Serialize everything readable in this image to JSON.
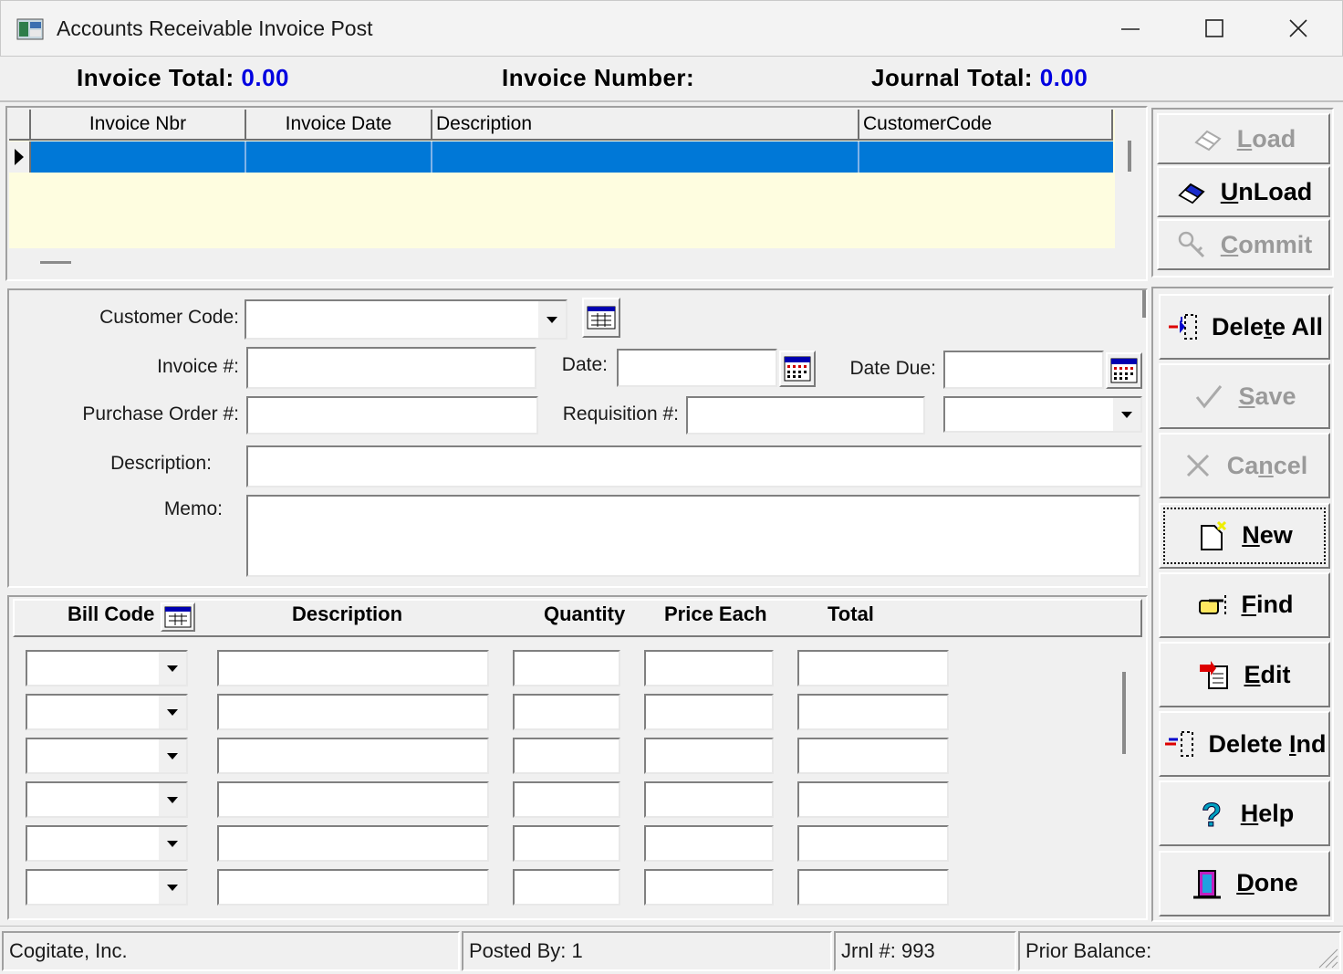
{
  "window": {
    "title": "Accounts Receivable Invoice Post"
  },
  "summary": {
    "invoice_total_label": "Invoice Total:",
    "invoice_total_value": "0.00",
    "invoice_number_label": "Invoice Number:",
    "invoice_number_value": "",
    "journal_total_label": "Journal Total:",
    "journal_total_value": "0.00"
  },
  "invoice_grid": {
    "columns": [
      "Invoice Nbr",
      "Invoice Date",
      "Description",
      "CustomerCode"
    ]
  },
  "form": {
    "customer_code_label": "Customer Code:",
    "invoice_no_label": "Invoice #:",
    "date_label": "Date:",
    "date_due_label": "Date Due:",
    "po_label": "Purchase Order #:",
    "requisition_label": "Requisition #:",
    "description_label": "Description:",
    "memo_label": "Memo:"
  },
  "detail": {
    "columns": [
      "Bill Code",
      "Description",
      "Quantity",
      "Price Each",
      "Total"
    ],
    "row_count": 6
  },
  "buttons_top": [
    {
      "name": "load-button",
      "label": "Load",
      "ul": "L",
      "rest": "oad",
      "enabled": false,
      "icon": "eraser-icon"
    },
    {
      "name": "unload-button",
      "label": "UnLoad",
      "ul": "U",
      "rest": "nLoad",
      "enabled": true,
      "icon": "blue-eraser-icon"
    },
    {
      "name": "commit-button",
      "label": "Commit",
      "ul": "C",
      "rest": "ommit",
      "enabled": false,
      "icon": "key-icon"
    }
  ],
  "buttons_side": [
    {
      "name": "delete-all-button",
      "label": "Delete All",
      "pre": "Dele",
      "ul": "t",
      "rest": "e All",
      "enabled": true,
      "icon": "delete-all-icon"
    },
    {
      "name": "save-button",
      "label": "Save",
      "pre": "",
      "ul": "S",
      "rest": "ave",
      "enabled": false,
      "icon": "checkmark-icon"
    },
    {
      "name": "cancel-button",
      "label": "Cancel",
      "pre": "Ca",
      "ul": "n",
      "rest": "cel",
      "enabled": false,
      "icon": "x-icon"
    },
    {
      "name": "new-button",
      "label": "New",
      "pre": "",
      "ul": "N",
      "rest": "ew",
      "enabled": true,
      "icon": "new-document-icon"
    },
    {
      "name": "find-button",
      "label": "Find",
      "pre": "",
      "ul": "F",
      "rest": "ind",
      "enabled": true,
      "icon": "pointing-hand-icon"
    },
    {
      "name": "edit-button",
      "label": "Edit",
      "pre": "",
      "ul": "E",
      "rest": "dit",
      "enabled": true,
      "icon": "edit-document-icon"
    },
    {
      "name": "delete-ind-button",
      "label": "Delete Ind",
      "pre": "Delete ",
      "ul": "I",
      "rest": "nd",
      "enabled": true,
      "icon": "delete-ind-icon"
    },
    {
      "name": "help-button",
      "label": "Help",
      "pre": "",
      "ul": "H",
      "rest": "elp",
      "enabled": true,
      "icon": "question-mark-icon"
    },
    {
      "name": "done-button",
      "label": "Done",
      "pre": "",
      "ul": "D",
      "rest": "one",
      "enabled": true,
      "icon": "door-icon"
    }
  ],
  "status_bar": {
    "company": "Cogitate, Inc.",
    "posted_by": "Posted By: 1",
    "journal_no": "Jrnl #: 993",
    "prior_balance": "Prior Balance:"
  }
}
